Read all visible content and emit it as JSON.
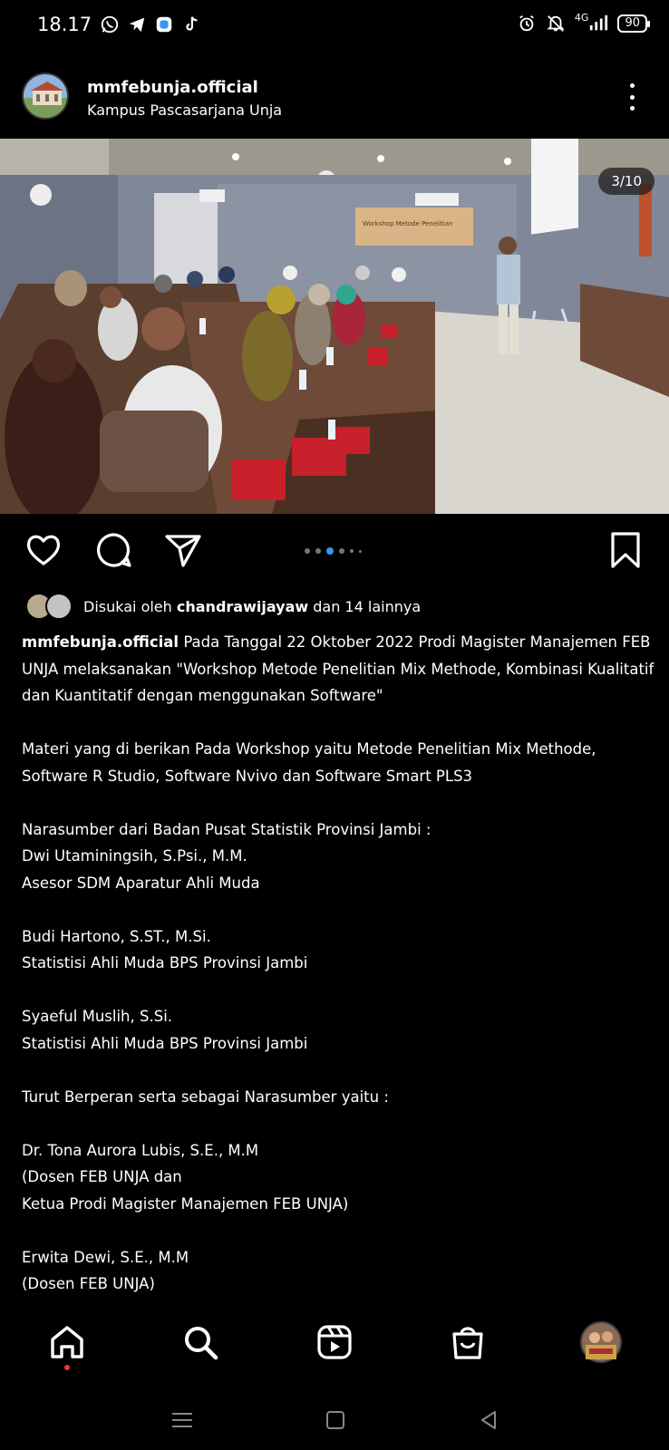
{
  "status": {
    "time": "18.17",
    "network": "4G",
    "battery": "90"
  },
  "post": {
    "username": "mmfebunja.official",
    "location": "Kampus Pascasarjana Unja",
    "counter": "3/10",
    "image_banner": "Workshop Metode Penelitian"
  },
  "likes": {
    "prefix": "Disukai oleh",
    "user": "chandrawijayaw",
    "suffix": "dan 14 lainnya"
  },
  "caption": {
    "username": "mmfebunja.official",
    "first_line": " Pada Tanggal 22 Oktober 2022 Prodi Magister Manajemen FEB",
    "lines": [
      "UNJA melaksanakan \"Workshop Metode Penelitian Mix Methode, Kombinasi Kualitatif",
      "dan Kuantitatif dengan menggunakan Software\"",
      "",
      "Materi yang di berikan Pada Workshop yaitu Metode Penelitian Mix Methode,",
      "Software R Studio, Software Nvivo dan Software Smart PLS3",
      "",
      "Narasumber dari Badan Pusat Statistik Provinsi Jambi :",
      "Dwi Utaminingsih, S.Psi., M.M.",
      "Asesor SDM Aparatur Ahli Muda",
      "",
      "Budi Hartono, S.ST., M.Si.",
      "Statistisi Ahli Muda BPS Provinsi Jambi",
      "",
      "Syaeful Muslih, S.Si.",
      "Statistisi Ahli Muda BPS Provinsi Jambi",
      "",
      "Turut Berperan serta sebagai Narasumber yaitu :",
      "",
      "Dr. Tona Aurora Lubis, S.E., M.M",
      "(Dosen FEB UNJA dan",
      "Ketua Prodi Magister Manajemen FEB UNJA)",
      "",
      "Erwita Dewi, S.E., M.M",
      "(Dosen FEB UNJA)"
    ]
  },
  "carousel": {
    "total_dots": 6,
    "active_index": 2
  },
  "icons": {
    "like": "heart-icon",
    "comment": "comment-icon",
    "share": "send-icon",
    "save": "bookmark-icon",
    "home": "home-icon",
    "search": "search-icon",
    "reels": "reels-icon",
    "shop": "shop-icon"
  },
  "colors": {
    "accent": "#3897f0",
    "notification": "#ff3040"
  }
}
